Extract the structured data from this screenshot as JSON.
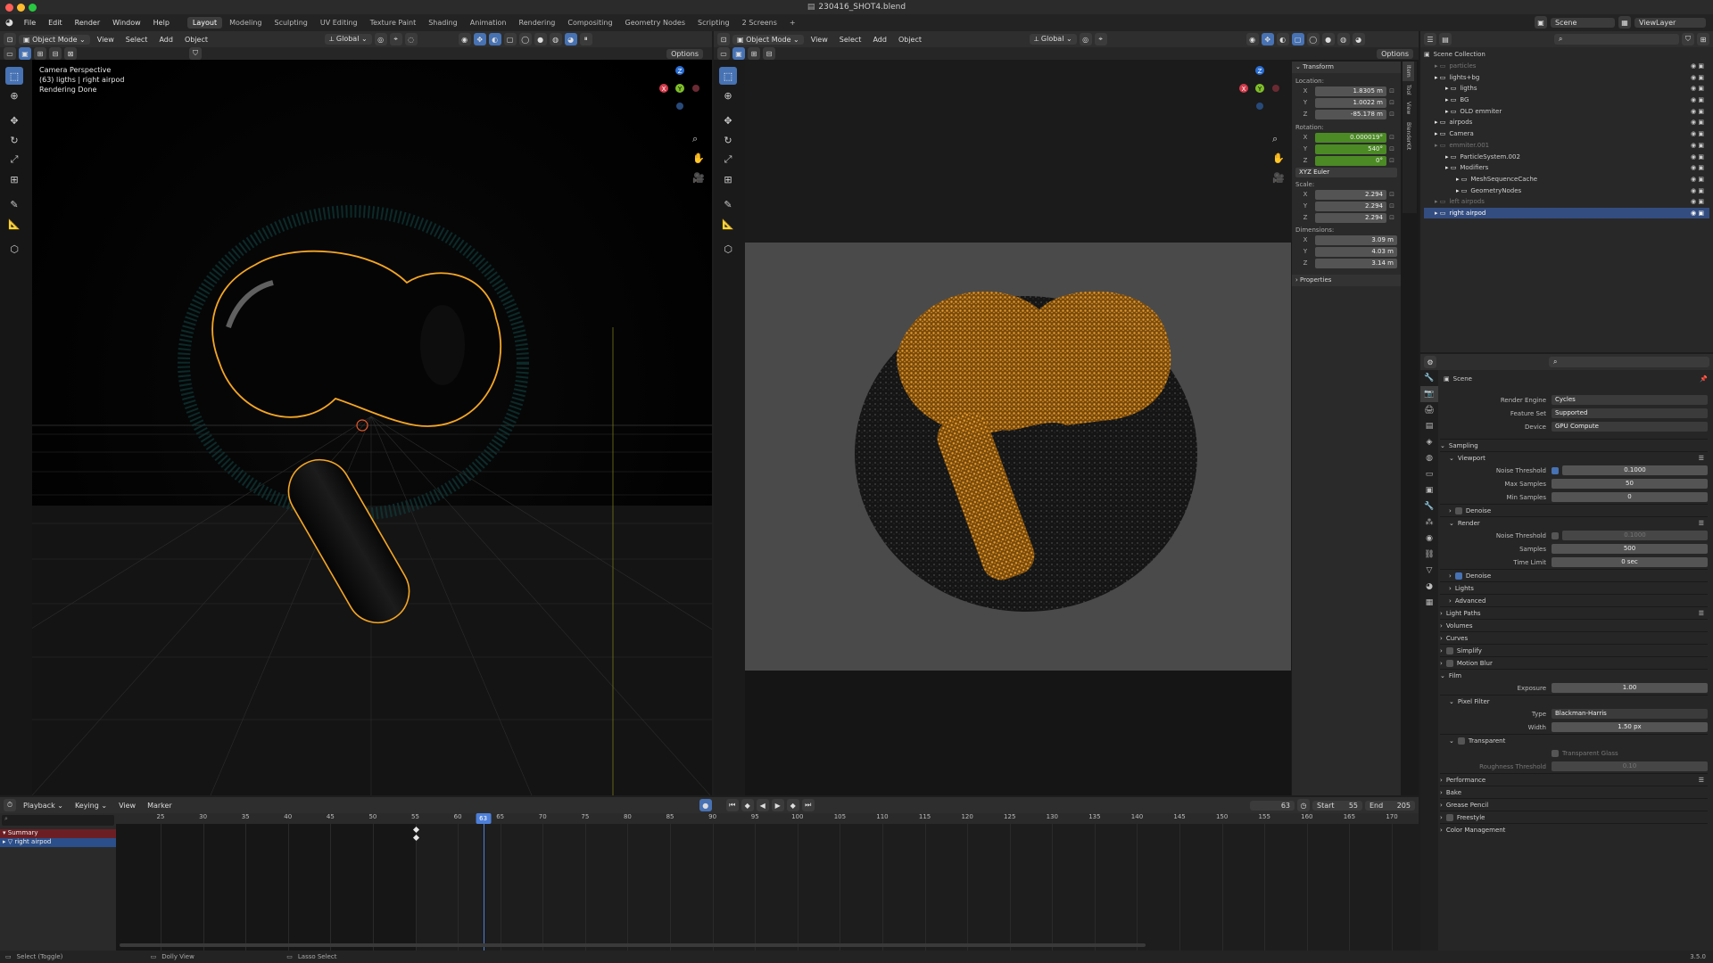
{
  "window": {
    "title": "230416_SHOT4.blend"
  },
  "menu": [
    "File",
    "Edit",
    "Render",
    "Window",
    "Help"
  ],
  "workspaces": [
    {
      "label": "Layout",
      "active": true
    },
    {
      "label": "Modeling"
    },
    {
      "label": "Sculpting"
    },
    {
      "label": "UV Editing"
    },
    {
      "label": "Texture Paint"
    },
    {
      "label": "Shading"
    },
    {
      "label": "Animation"
    },
    {
      "label": "Rendering"
    },
    {
      "label": "Compositing"
    },
    {
      "label": "Geometry Nodes"
    },
    {
      "label": "Scripting"
    },
    {
      "label": "2 Screens"
    }
  ],
  "topbar_right": {
    "scene": "Scene",
    "view_layer": "ViewLayer"
  },
  "viewport_left": {
    "mode": "Object Mode",
    "menus": [
      "View",
      "Select",
      "Add",
      "Object"
    ],
    "orientation": "Global",
    "options": "Options",
    "overlay": [
      "Camera Perspective",
      "(63) ligths | right airpod",
      "Rendering Done"
    ]
  },
  "viewport_right": {
    "mode": "Object Mode",
    "menus": [
      "View",
      "Select",
      "Add",
      "Object"
    ],
    "orientation": "Global",
    "options": "Options"
  },
  "gizmo": {
    "x": "X",
    "y": "Y",
    "z": "Z"
  },
  "npanel": {
    "title": "Transform",
    "location_label": "Location:",
    "location": [
      {
        "axis": "X",
        "value": "1.8305 m"
      },
      {
        "axis": "Y",
        "value": "1.0022 m"
      },
      {
        "axis": "Z",
        "value": "-85.178 m"
      }
    ],
    "rotation_label": "Rotation:",
    "rotation": [
      {
        "axis": "X",
        "value": "0.000019°"
      },
      {
        "axis": "Y",
        "value": "540°"
      },
      {
        "axis": "Z",
        "value": "0°"
      }
    ],
    "rotation_mode": "XYZ Euler",
    "scale_label": "Scale:",
    "scale": [
      {
        "axis": "X",
        "value": "2.294"
      },
      {
        "axis": "Y",
        "value": "2.294"
      },
      {
        "axis": "Z",
        "value": "2.294"
      }
    ],
    "dimensions_label": "Dimensions:",
    "dimensions": [
      {
        "axis": "X",
        "value": "3.09 m"
      },
      {
        "axis": "Y",
        "value": "4.03 m"
      },
      {
        "axis": "Z",
        "value": "3.14 m"
      }
    ],
    "properties": "Properties",
    "tabs": [
      "Item",
      "Tool",
      "View",
      "BlenderKit"
    ]
  },
  "outliner": {
    "root": "Scene Collection",
    "rows": [
      {
        "label": "particles",
        "indent": 1,
        "dim": true
      },
      {
        "label": "lights+bg",
        "indent": 1
      },
      {
        "label": "ligths",
        "indent": 2
      },
      {
        "label": "BG",
        "indent": 2
      },
      {
        "label": "OLD emmiter",
        "indent": 2
      },
      {
        "label": "airpods",
        "indent": 1
      },
      {
        "label": "Camera",
        "indent": 1
      },
      {
        "label": "emmiter.001",
        "indent": 1,
        "dim": true
      },
      {
        "label": "ParticleSystem.002",
        "indent": 2
      },
      {
        "label": "Modifiers",
        "indent": 2
      },
      {
        "label": "MeshSequenceCache",
        "indent": 3
      },
      {
        "label": "GeometryNodes",
        "indent": 3
      },
      {
        "label": "left airpods",
        "indent": 1,
        "dim": true
      },
      {
        "label": "right airpod",
        "indent": 1,
        "selected": true
      }
    ]
  },
  "properties": {
    "context": "Scene",
    "render_engine_label": "Render Engine",
    "render_engine": "Cycles",
    "feature_set_label": "Feature Set",
    "feature_set": "Supported",
    "device_label": "Device",
    "device": "GPU Compute",
    "sampling": "Sampling",
    "viewport": "Viewport",
    "noise_threshold_label": "Noise Threshold",
    "vp_noise_threshold": "0.1000",
    "max_samples_label": "Max Samples",
    "vp_max_samples": "50",
    "min_samples_label": "Min Samples",
    "vp_min_samples": "0",
    "denoise": "Denoise",
    "render": "Render",
    "r_noise_threshold": "0.1000",
    "samples_label": "Samples",
    "r_samples": "500",
    "time_limit_label": "Time Limit",
    "r_time_limit": "0 sec",
    "lights": "Lights",
    "advanced": "Advanced",
    "light_paths": "Light Paths",
    "volumes": "Volumes",
    "curves": "Curves",
    "simplify": "Simplify",
    "motion_blur": "Motion Blur",
    "film": "Film",
    "exposure_label": "Exposure",
    "exposure": "1.00",
    "pixel_filter": "Pixel Filter",
    "type_label": "Type",
    "filter_type": "Blackman-Harris",
    "width_label": "Width",
    "filter_width": "1.50 px",
    "transparent": "Transparent",
    "transparent_glass": "Transparent Glass",
    "roughness_threshold_label": "Roughness Threshold",
    "roughness_threshold": "0.10",
    "performance": "Performance",
    "bake": "Bake",
    "grease_pencil": "Grease Pencil",
    "freestyle": "Freestyle",
    "color_management": "Color Management"
  },
  "timeline": {
    "menus": [
      "Playback",
      "Keying",
      "View",
      "Marker"
    ],
    "current_frame": "63",
    "start_label": "Start",
    "start": "55",
    "end_label": "End",
    "end": "205",
    "ticks": [
      "25",
      "30",
      "35",
      "40",
      "45",
      "50",
      "55",
      "60",
      "65",
      "70",
      "75",
      "80",
      "85",
      "90",
      "95",
      "100",
      "105",
      "110",
      "115",
      "120",
      "125",
      "130",
      "135",
      "140",
      "145",
      "150",
      "155",
      "160",
      "165",
      "170"
    ],
    "playhead": "63",
    "channels": [
      "Summary",
      "right airpod"
    ]
  },
  "statusbar": {
    "left": "Select (Toggle)",
    "mid": "Dolly View",
    "right": "Lasso Select",
    "version": "3.5.0"
  },
  "colors": {
    "accent": "#4772b3",
    "selection": "#f5a623",
    "header": "#2e2e2e"
  }
}
